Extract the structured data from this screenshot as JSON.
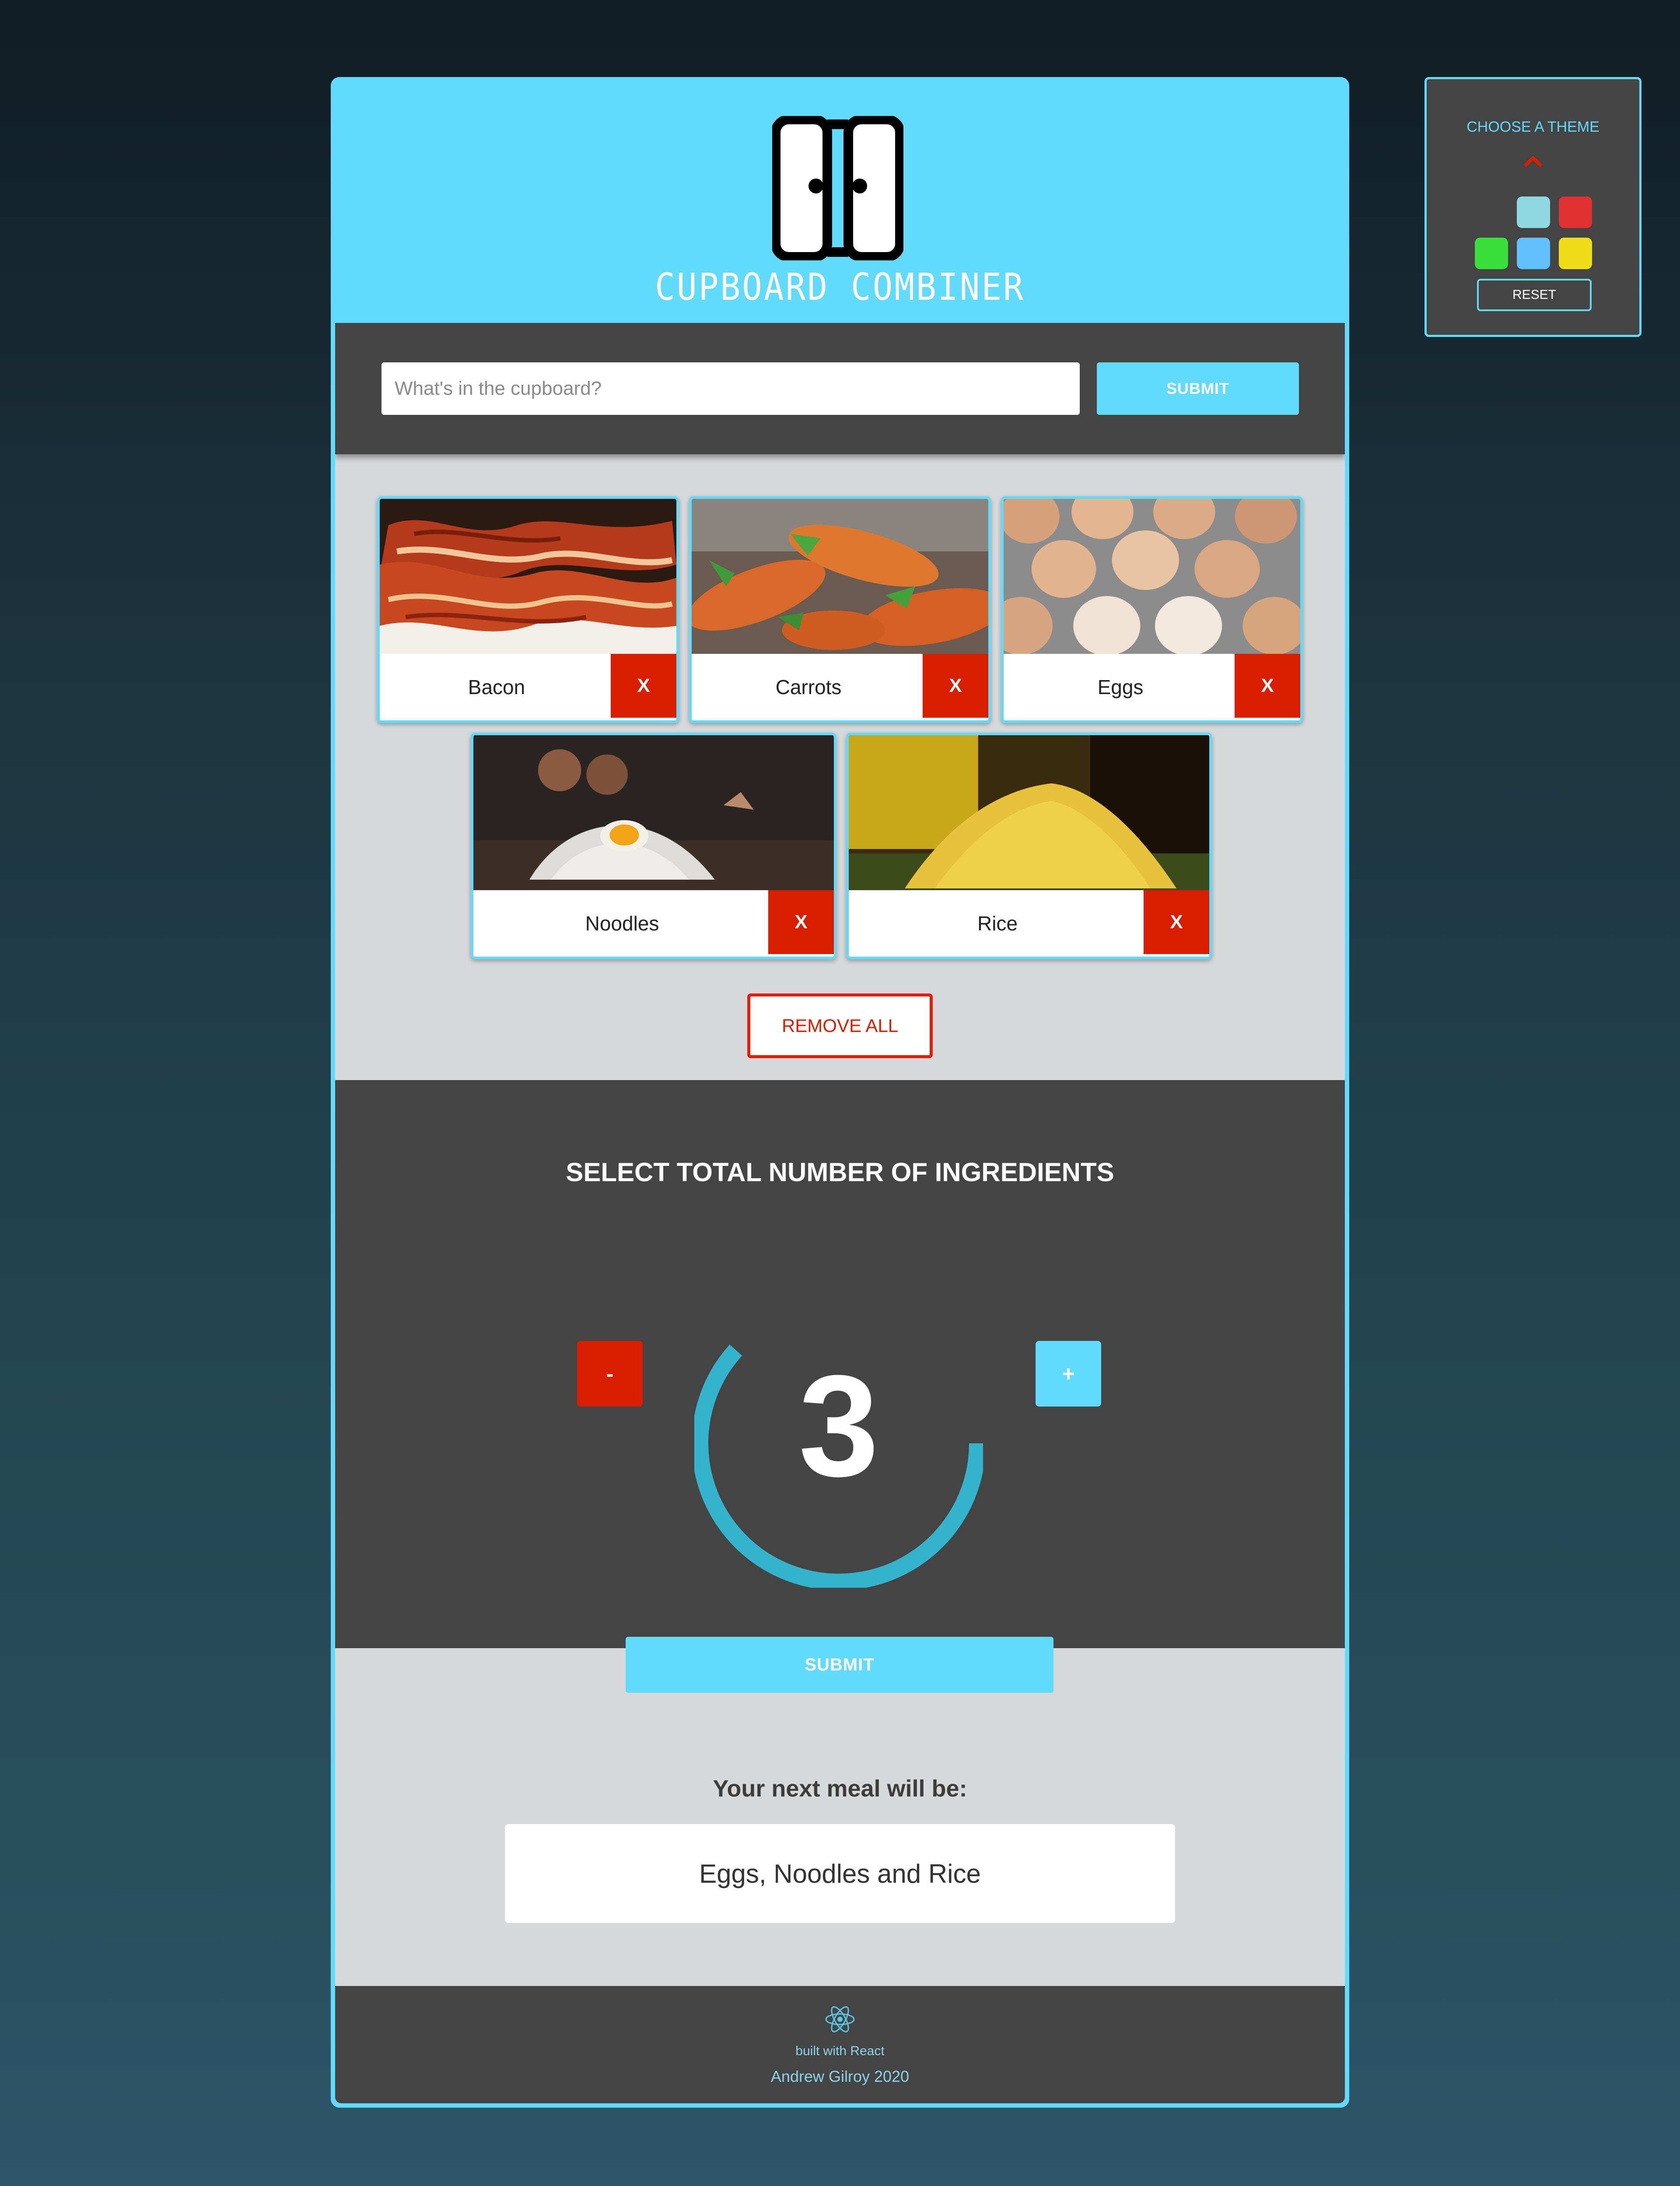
{
  "app": {
    "title": "CUPBOARD COMBINER"
  },
  "search": {
    "placeholder": "What's in the cupboard?",
    "value": "",
    "submit_label": "SUBMIT"
  },
  "ingredients": [
    {
      "label": "Bacon",
      "remove_label": "X",
      "image": "bacon-photo"
    },
    {
      "label": "Carrots",
      "remove_label": "X",
      "image": "carrots-photo"
    },
    {
      "label": "Eggs",
      "remove_label": "X",
      "image": "eggs-photo"
    },
    {
      "label": "Noodles",
      "remove_label": "X",
      "image": "flour-egg-photo"
    },
    {
      "label": "Rice",
      "remove_label": "X",
      "image": "rice-photo"
    }
  ],
  "remove_all_label": "REMOVE ALL",
  "counter": {
    "title": "SELECT TOTAL NUMBER OF INGREDIENTS",
    "minus_label": "-",
    "plus_label": "+",
    "value": "3",
    "submit_label": "SUBMIT"
  },
  "result": {
    "heading": "Your next meal will be:",
    "text": "Eggs, Noodles and Rice"
  },
  "footer": {
    "built_with": "built with React",
    "author": "Andrew Gilroy 2020"
  },
  "theme": {
    "title": "CHOOSE A THEME",
    "reset_label": "RESET",
    "swatches": [
      "#444444",
      "#8fd8e0",
      "#e03030",
      "#3adf3a",
      "#61c0ff",
      "#f0dd18"
    ]
  },
  "colors": {
    "accent": "#61dafb",
    "danger": "#d91e00",
    "dark_panel": "#444444",
    "light_panel": "#d7d8da"
  }
}
